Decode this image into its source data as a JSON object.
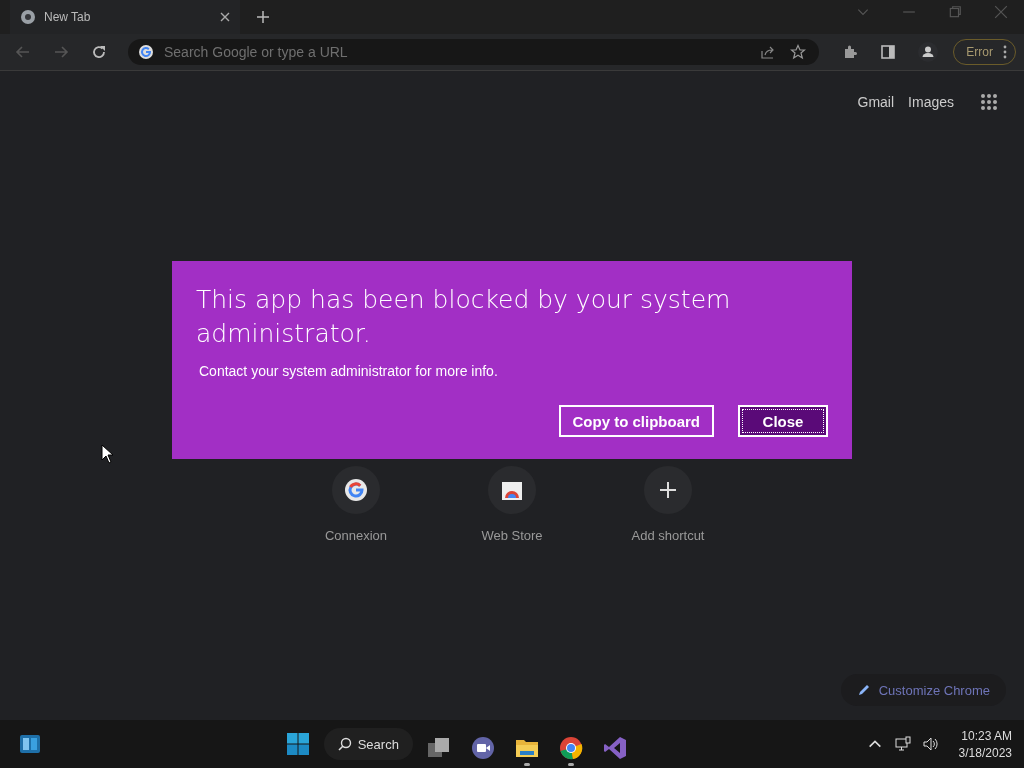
{
  "browser": {
    "tab": {
      "title": "New Tab"
    },
    "omnibox": {
      "placeholder": "Search Google or type a URL"
    },
    "profile_button": "Error"
  },
  "ntp": {
    "links": [
      "Gmail",
      "Images"
    ],
    "shortcuts": [
      {
        "label": "Connexion",
        "kind": "google"
      },
      {
        "label": "Web Store",
        "kind": "store"
      },
      {
        "label": "Add shortcut",
        "kind": "add"
      }
    ],
    "customize_button": "Customize Chrome"
  },
  "dialog": {
    "title": "This app has been blocked by your system administrator.",
    "message": "Contact your system administrator for more info.",
    "buttons": [
      {
        "label": "Copy to clipboard",
        "selected": false
      },
      {
        "label": "Close",
        "selected": true
      }
    ]
  },
  "taskbar": {
    "search": "Search",
    "apps": [
      {
        "kind": "taskview",
        "running": false
      },
      {
        "kind": "teams",
        "running": false
      },
      {
        "kind": "files",
        "running": true
      },
      {
        "kind": "chrome",
        "running": true
      },
      {
        "kind": "studio",
        "running": false
      }
    ],
    "time": "10:23 AM",
    "date": "3/18/2023"
  }
}
